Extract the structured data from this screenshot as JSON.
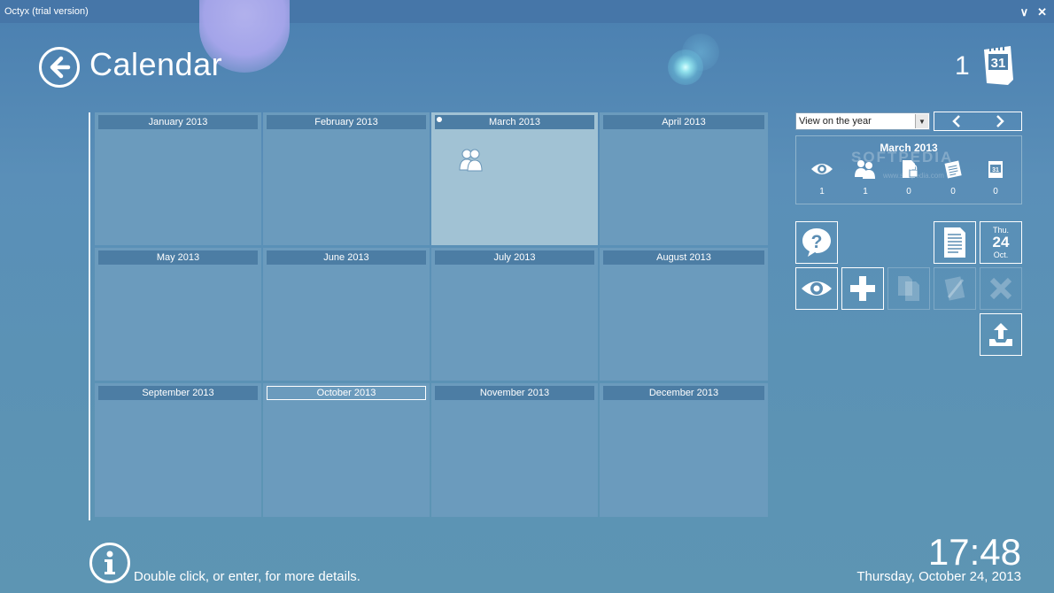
{
  "window": {
    "title": "Octyx (trial version)",
    "minimize": "∨",
    "close": "✕"
  },
  "header": {
    "title": "Calendar",
    "count": "1"
  },
  "icons": {
    "calendar_day": "31"
  },
  "months": [
    {
      "label": "January 2013"
    },
    {
      "label": "February 2013"
    },
    {
      "label": "March 2013"
    },
    {
      "label": "April 2013"
    },
    {
      "label": "May 2013"
    },
    {
      "label": "June 2013"
    },
    {
      "label": "July 2013"
    },
    {
      "label": "August 2013"
    },
    {
      "label": "September 2013"
    },
    {
      "label": "October 2013"
    },
    {
      "label": "November 2013"
    },
    {
      "label": "December 2013"
    }
  ],
  "view_select": {
    "value": "View on the year"
  },
  "summary": {
    "title": "March 2013",
    "watermark": "SOFTPEDIA",
    "watermark_sub": "www.softpedia.com",
    "stats": [
      {
        "icon": "eye-icon",
        "value": "1"
      },
      {
        "icon": "contacts-icon",
        "value": "1"
      },
      {
        "icon": "lock-document-icon",
        "value": "0"
      },
      {
        "icon": "note-icon",
        "value": "0"
      },
      {
        "icon": "calendar-icon",
        "value": "0"
      }
    ]
  },
  "today_tile": {
    "day": "Thu.",
    "num": "24",
    "month": "Oct."
  },
  "footer": {
    "hint": "Double click, or enter, for more details.",
    "time": "17:48",
    "date": "Thursday, October 24, 2013"
  }
}
